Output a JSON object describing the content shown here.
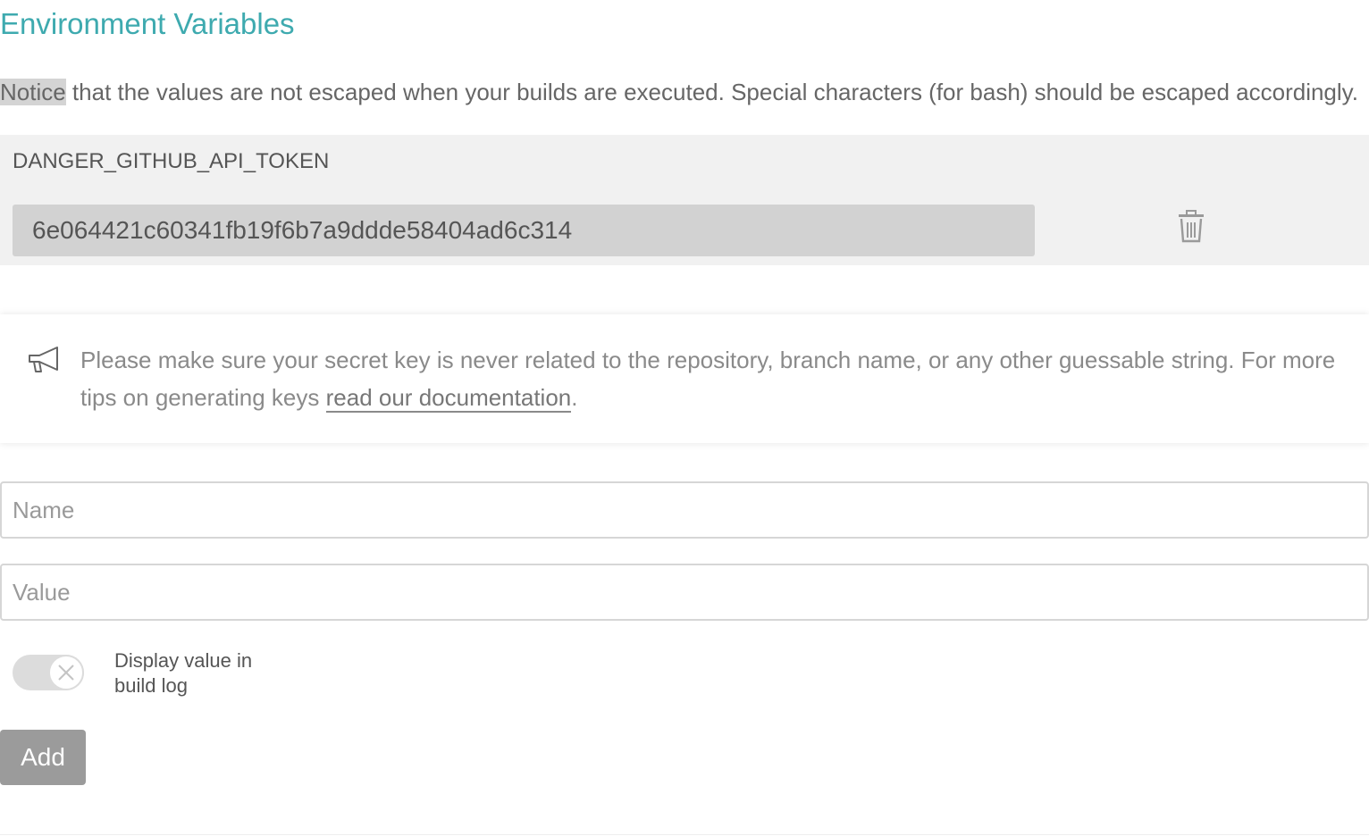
{
  "section": {
    "title": "Environment Variables",
    "notice_highlight": "Notice",
    "notice_rest": " that the values are not escaped when your builds are executed. Special characters (for bash) should be escaped accordingly."
  },
  "variables": [
    {
      "name": "DANGER_GITHUB_API_TOKEN",
      "value": "6e064421c60341fb19f6b7a9ddde58404ad6c314",
      "delete_icon": "trash-icon"
    }
  ],
  "tip": {
    "icon": "megaphone-icon",
    "text": "Please make sure your secret key is never related to the repository, branch name, or any other guessable string. For more tips on generating keys ",
    "link_text": "read our documentation",
    "suffix": "."
  },
  "form": {
    "name_placeholder": "Name",
    "value_placeholder": "Value",
    "display_toggle": {
      "label": "Display value in build log",
      "checked": false
    },
    "add_label": "Add"
  },
  "colors": {
    "title": "#3eaaaf",
    "row_background": "#f1f1f1",
    "value_background": "#d2d2d2",
    "button_background": "#9b9b9b"
  }
}
